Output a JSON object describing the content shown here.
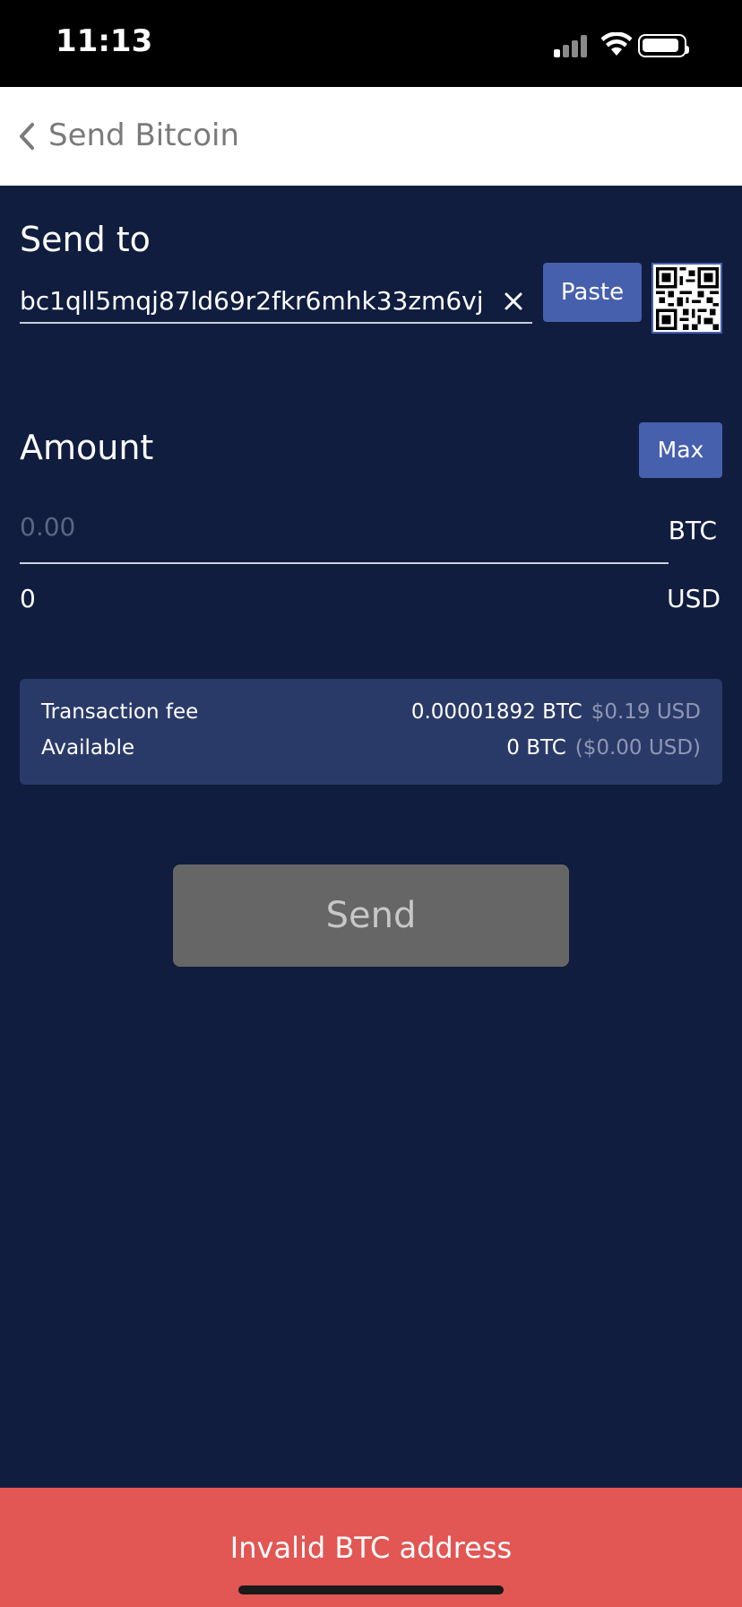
{
  "status_bar": {
    "time": "11:13"
  },
  "nav": {
    "title": "Send Bitcoin",
    "back_icon": "chevron-left-icon"
  },
  "send_to": {
    "label": "Send to",
    "address_value": "bc1qll5mqj87ld69r2fkr6mhk33zm6vj...",
    "paste_label": "Paste",
    "clear_icon": "close-icon",
    "qr_icon": "qr-code-icon"
  },
  "amount": {
    "label": "Amount",
    "max_label": "Max",
    "placeholder": "0.00",
    "btc_unit": "BTC",
    "usd_value": "0",
    "usd_unit": "USD"
  },
  "fees": {
    "transaction_fee_label": "Transaction fee",
    "transaction_fee_btc": "0.00001892 BTC",
    "transaction_fee_usd": "$0.19 USD",
    "available_label": "Available",
    "available_btc": "0 BTC",
    "available_usd": "($0.00 USD)"
  },
  "send_button_label": "Send",
  "error": {
    "message": "Invalid BTC address"
  },
  "colors": {
    "background": "#101d3f",
    "accent_button": "#4660ad",
    "fee_panel": "#2a3a68",
    "disabled_button": "#666666",
    "error_banner": "#e25653"
  }
}
